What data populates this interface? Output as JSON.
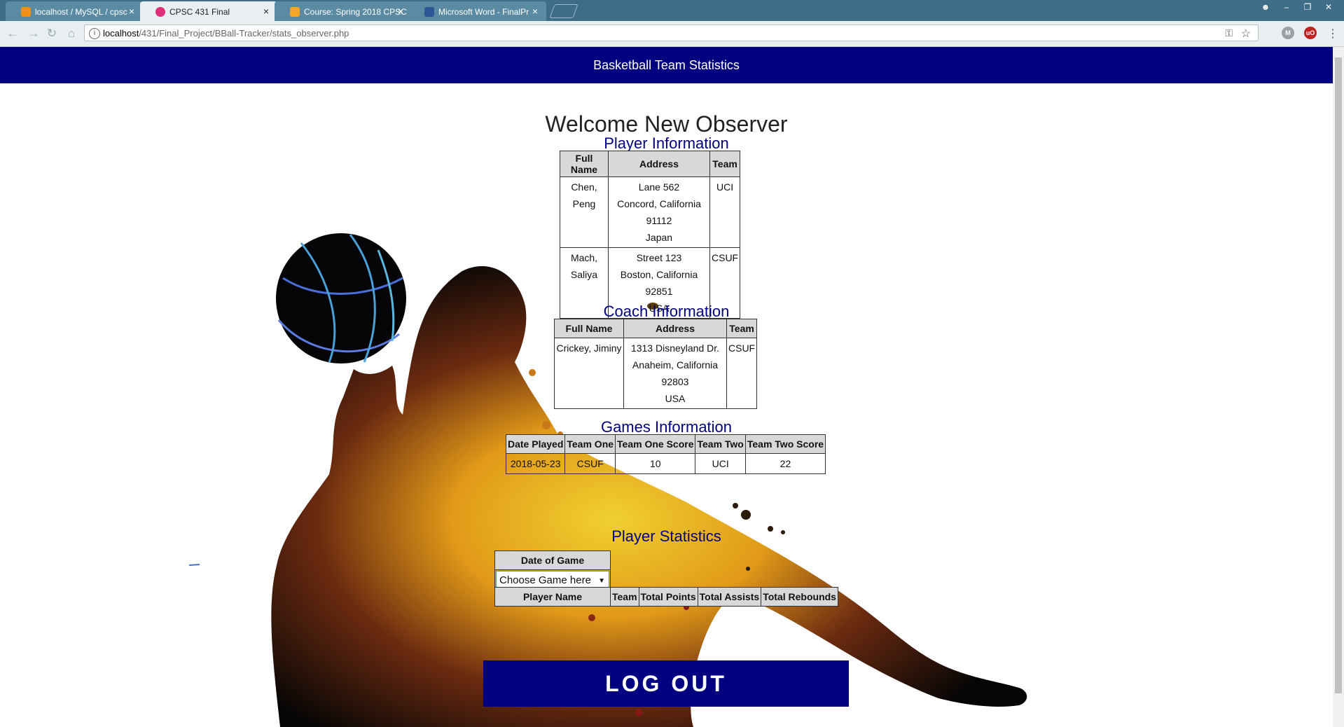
{
  "browser": {
    "tabs": [
      {
        "title": "localhost / MySQL / cpsc",
        "close": "×"
      },
      {
        "title": "CPSC 431 Final",
        "close": "×"
      },
      {
        "title": "Course: Spring 2018 CPSC",
        "close": "×"
      },
      {
        "title": "Microsoft Word - FinalPr",
        "close": "×"
      }
    ],
    "url_host": "localhost",
    "url_path": "/431/Final_Project/BBall-Tracker/stats_observer.php",
    "extensions": [
      "M",
      "uO"
    ]
  },
  "header": {
    "title": "Basketball Team Statistics"
  },
  "welcome": "Welcome New Observer",
  "player_info": {
    "title": "Player Information",
    "headers": [
      "Full Name",
      "Address",
      "Team"
    ],
    "rows": [
      {
        "name": "Chen, Peng",
        "street": "Lane 562",
        "city": "Concord, California 91112",
        "country": "Japan",
        "team": "UCI"
      },
      {
        "name": "Mach, Saliya",
        "street": "Street 123",
        "city": "Boston, California 92851",
        "country": "USA",
        "team": "CSUF"
      }
    ]
  },
  "coach_info": {
    "title": "Coach Information",
    "headers": [
      "Full Name",
      "Address",
      "Team"
    ],
    "rows": [
      {
        "name": "Crickey, Jiminy",
        "street": "1313 Disneyland Dr.",
        "city": "Anaheim, California 92803",
        "country": "USA",
        "team": "CSUF"
      }
    ]
  },
  "games_info": {
    "title": "Games Information",
    "headers": [
      "Date Played",
      "Team One",
      "Team One Score",
      "Team Two",
      "Team Two Score"
    ],
    "rows": [
      {
        "date": "2018-05-23",
        "team_one": "CSUF",
        "team_one_score": "10",
        "team_two": "UCI",
        "team_two_score": "22"
      }
    ]
  },
  "player_stats": {
    "title": "Player Statistics",
    "date_header": "Date of Game",
    "select_value": "Choose Game here",
    "headers": [
      "Player Name",
      "Team",
      "Total Points",
      "Total Assists",
      "Total Rebounds"
    ]
  },
  "logout": "LOG OUT",
  "colors": {
    "navy": "#000080",
    "tabbar": "#3f6c86"
  }
}
